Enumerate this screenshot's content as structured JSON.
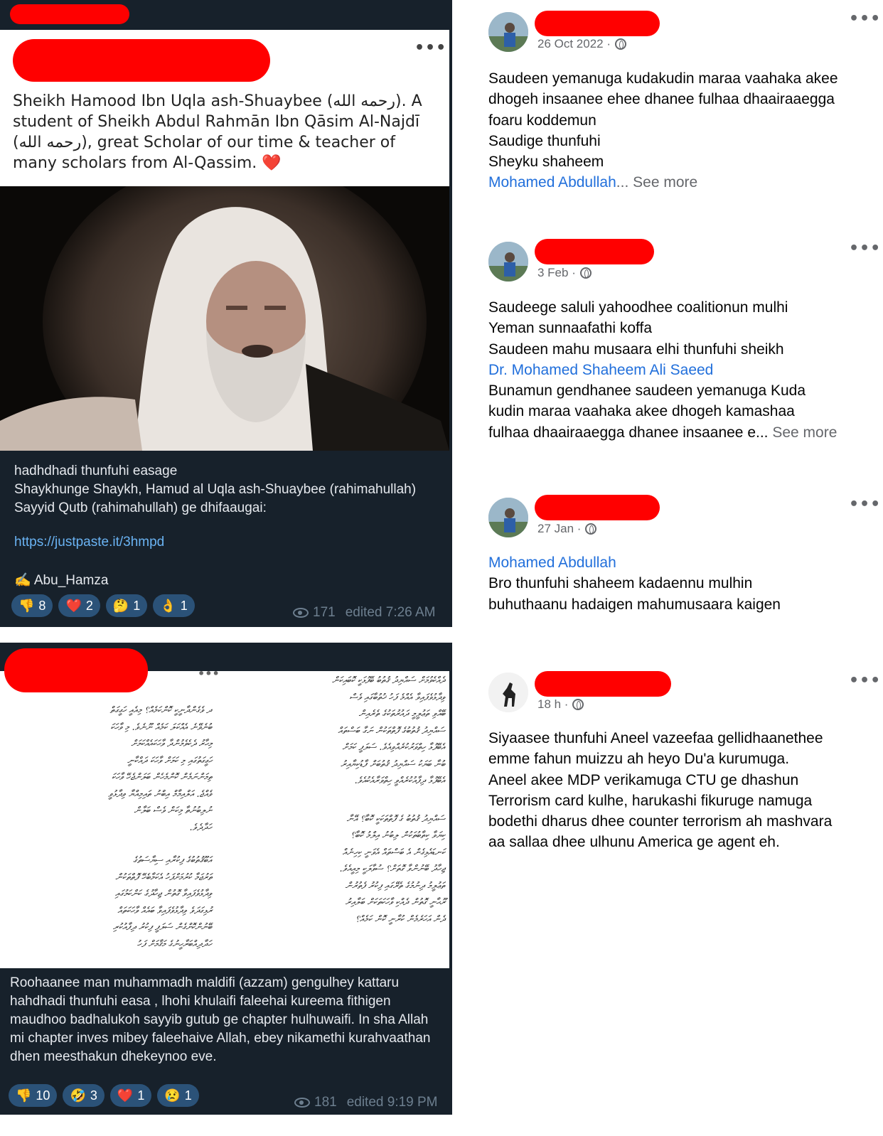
{
  "colors": {
    "telegram_bg": "#17212b",
    "redaction": "#ff0000",
    "link": "#6ab3f3",
    "fb_link": "#216fdb",
    "reaction_bg": "#2b5278"
  },
  "post1": {
    "quote": "Sheikh Hamood Ibn Uqla ash-Shuaybee (رحمه الله). A student of Sheikh Abdul Rahmān Ibn Qāsim Al-Najdī (رحمه الله), great Scholar of our time & teacher of many scholars from Al-Qassim. ❤️",
    "caption_lines": [
      "hadhdhadi thunfuhi easage",
      "Shaykhunge Shaykh, Hamud al Uqla ash-Shuaybee (rahimahullah)",
      "Sayyid Qutb (rahimahullah) ge dhifaaugai:"
    ],
    "link": "https://justpaste.it/3hmpd",
    "author": "✍️ Abu_Hamza",
    "reactions": [
      {
        "emoji": "👎",
        "count": "8"
      },
      {
        "emoji": "❤️",
        "count": "2"
      },
      {
        "emoji": "🤔",
        "count": "1"
      },
      {
        "emoji": "👌",
        "count": "1"
      }
    ],
    "views": "171",
    "edited": "edited 7:26 AM"
  },
  "post2": {
    "doc_left_lines": [
      "ދ ވެގެންދާނީކީ ކޮންކަމެއް؟ މިއެއީ ހަގީގަތް",
      "ބުނެވޭނެ އެއްކަލަ ކަމެއް ނޫނެވެ. މި ވާހަކަ",
      "މިހާރު ދެކެވެމުންދާ ވާހަކައެއްކަމަށް",
      "ހަގީގަތުގައި މި ކަމަށް ވާހަކަ ދައްކާނީ",
      "ތިމަންނަމެން ކޮންމެހެން ބަލަންޖެހޭ ވާހަކަ",
      "ވެއްޖެ. އަލްއިމާމް އިބްނު ތައިމިއްޔާ ވިދާޅުވީ",
      "ނުލިބުނުތާ މިކަން ވެސް ބަލާން",
      "ހަދާދެވެ.",
      "",
      "އަބޫޤުތުބުގެ ފިކުރާއި ސިޔާސަތުގެ",
      "ތަރުޖަމާ ކުރުމަށްފަހު އެކަމާބެހޭ ފޮތްތަކުން",
      "ވިދާޅުވެފައިވާ ގޮތުން ޖިހާދުގެ ކަންކަމުގައި",
      "ރުޅިގަދަވެ ވިދާޅުވެފައިވާ ބައެއް ވާހަކަތައް",
      "ބޭނުންކޮށްގެން ސަލަފީ ފިކުރު ދިފާއުކުރި",
      "ހަދާދިއްބަރާހީނުގެ މަޤާމަށް ފަހު"
    ],
    "doc_right_lines": [
      "ދެއްކެވުމަށް ސައްޔިދު ޤުތުބު ބޭފުޅަކީ ކޮބައިކަން",
      "ވިދާޅުވެފައިވާ އެއްމެ ފަހު ޚުތުބާގައި ވެސް",
      "ބޭއްވި ތަޢުލީމީ ދައުރުތަކުގެ ތެރެއިން",
      "ސައްޔިދު ޤުތުބުގެ ފޮތްތަކުން ނަގާ ބަސްތައް",
      "އެބޭފުޅާ ހިތްވަރުކުރެއްވިއެވެ. ސަލަފީ ކަމަށް",
      "ބުނާ ބަޔަކު ސައްޔިދު ޤުތުބަށް ފާޑުކިޔާއިރު",
      "އެބޭފުޅާ ދިފާއުކުރެއްވީ ހިތްވަރާއެކުއެވެ.",
      "",
      "ސައްޔިދު ޤުތުބު ގެ ފޮތްތަކަކީ ކޮބާ؟ އޭނާ",
      "ކިޔަވާ ކިތާބުތަކުން ލިބުނު އިލްމު ކޮބާ؟",
      "ކަނޑައެޅިގެން އެ ބަސްތައް އެވަނީ ކިހިނެއް",
      "ޖިހާދު ބޭނުންވާ ގޮތަށް؟ ސުވާލަކީ މިއީއެވެ.",
      "ތަޢުލީމު ދިނުމުގެ ތެރޭގައި ފިކުރު ފެތުރުން",
      "ރޫޙާނީ ގޮތުން ދެއްކި ވާހަކަތަކަށް ބަލާއިރު",
      "ދެން އަހަރެމެން ކުރާނީ ކޮން ކަމެއް؟"
    ],
    "caption": "Roohaanee man muhammadh maldifi (azzam) gengulhey kattaru hahdhadi thunfuhi easa , lhohi khulaifi faleehai kureema fithigen maudhoo badhalukoh sayyib gutub ge chapter hulhuwaifi. In sha Allah mi chapter inves mibey faleehaive Allah,  ebey nikamethi kurahvaathan dhen meesthakun dhekeynoo eve.",
    "reactions": [
      {
        "emoji": "👎",
        "count": "10"
      },
      {
        "emoji": "🤣",
        "count": "3"
      },
      {
        "emoji": "❤️",
        "count": "1"
      },
      {
        "emoji": "😢",
        "count": "1"
      }
    ],
    "views": "181",
    "edited": "edited 9:19 PM"
  },
  "fb": [
    {
      "date": "26 Oct 2022 ·",
      "lines": [
        "Saudeen yemanuga kudakudin maraa vaahaka akee",
        "dhogeh  insaanee ehee dhanee fulhaa dhaairaaegga",
        "foaru koddemun",
        "Saudige thunfuhi",
        "Sheyku shaheem"
      ],
      "link": "Mohamed Abdullah",
      "tail": "... See more"
    },
    {
      "date": "3 Feb ·",
      "lines_a": [
        "Saudeege saluli yahoodhee coalitionun mulhi",
        "Yeman sunnaafathi koffa",
        "Saudeen mahu musaara elhi thunfuhi sheikh"
      ],
      "link": "Dr. Mohamed Shaheem Ali Saeed",
      "lines_b": [
        "Bunamun gendhanee saudeen yemanuga Kuda",
        "kudin maraa vaahaka akee dhogeh kamashaa"
      ],
      "last_line": "fulhaa dhaairaaegga dhanee insaanee e...",
      "tail": " See more"
    },
    {
      "date": "27 Jan ·",
      "link": "Mohamed Abdullah",
      "lines": [
        "Bro thunfuhi shaheem kadaennu mulhin",
        "buhuthaanu hadaigen mahumusaara kaigen"
      ]
    },
    {
      "date": "18 h ·",
      "lines": [
        "Siyaasee thunfuhi Aneel vazeefaa gellidhaanethee",
        "emme fahun muizzu ah heyo Du'a kurumuga.",
        "Aneel akee MDP verikamuga CTU ge dhashun",
        "Terrorism card kulhe, harukashi fikuruge namuga",
        "bodethi dharus dhee counter terrorism ah mashvara",
        "aa sallaa dhee ulhunu America ge agent eh."
      ]
    }
  ]
}
